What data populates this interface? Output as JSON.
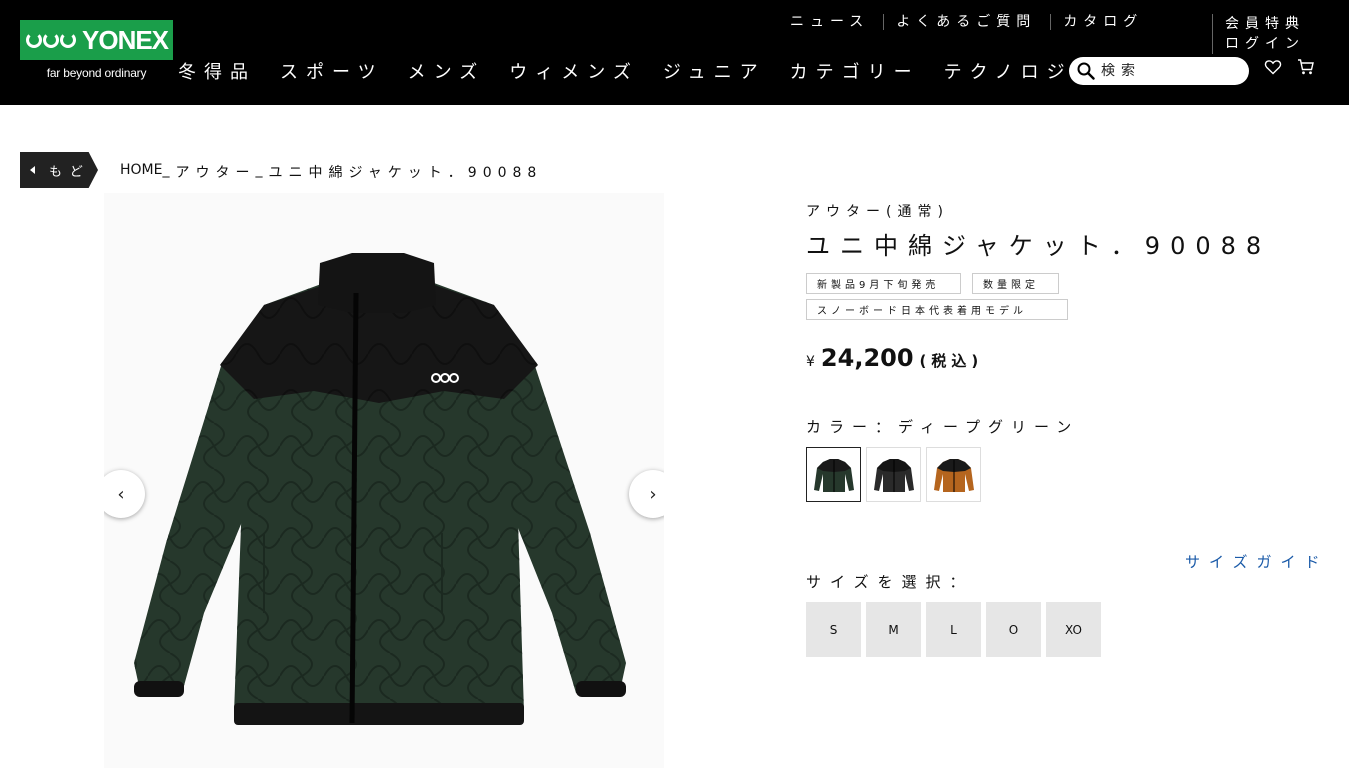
{
  "brand": {
    "name": "YONEX",
    "tagline": "far beyond ordinary"
  },
  "utility_nav": [
    "ニュース",
    "よくあるご質問",
    "カタログ"
  ],
  "account_nav": [
    "会員特典",
    "ログイン"
  ],
  "main_nav": [
    "冬得品",
    "スポーツ",
    "メンズ",
    "ウィメンズ",
    "ジュニア",
    "カテゴリー",
    "テクノロジー"
  ],
  "search": {
    "placeholder": "検索"
  },
  "header_icons": [
    "heart-icon",
    "cart-icon"
  ],
  "breadcrumb": {
    "back_label": "もど",
    "items": [
      "HOME",
      "アウター",
      "ユニ中綿ジャケット．90088"
    ],
    "separator": "_"
  },
  "product": {
    "category": "アウター(通常)",
    "title": "ユニ中綿ジャケット．90088",
    "tags": [
      "新製品9月下旬発売",
      "数量限定",
      "スノーボード日本代表着用モデル"
    ],
    "price": {
      "currency": "¥",
      "amount": "24,200",
      "tax_note": "(税込)"
    },
    "color_label": "カラー：ディープグリーン",
    "colors": [
      {
        "name": "deep-green",
        "body": "#26382c",
        "yoke": "#1a1a1a",
        "selected": true
      },
      {
        "name": "black",
        "body": "#2a2a2a",
        "yoke": "#151515",
        "selected": false
      },
      {
        "name": "orange",
        "body": "#b5651e",
        "yoke": "#1a1a1a",
        "selected": false
      }
    ],
    "size_guide": "サイズガイド",
    "size_label": "サイズを選択：",
    "sizes": [
      "S",
      "M",
      "L",
      "O",
      "XO"
    ]
  },
  "colors": {
    "header_bg": "#000000",
    "brand_green": "#1a9e4a",
    "link_blue": "#1a5aa8",
    "size_bg": "#e6e6e6"
  }
}
